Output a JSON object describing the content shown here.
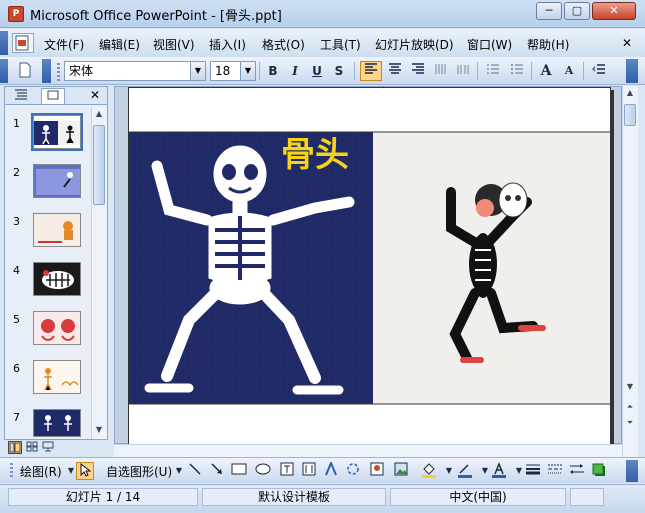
{
  "window": {
    "app_icon": "P",
    "title": "Microsoft Office PowerPoint - [骨头.ppt]",
    "minimize": "─",
    "restore": "▢",
    "close": "✕"
  },
  "menu": {
    "items": [
      "文件(F)",
      "编辑(E)",
      "视图(V)",
      "插入(I)",
      "格式(O)",
      "工具(T)",
      "幻灯片放映(D)",
      "窗口(W)",
      "帮助(H)"
    ],
    "close_doc": "✕"
  },
  "toolbar": {
    "font_name": "宋体",
    "font_size": "18",
    "bold": "B",
    "italic": "I",
    "underline": "U",
    "shadow": "S",
    "increase_font": "A",
    "decrease_font": "A"
  },
  "slides_pane": {
    "tab_close": "✕",
    "slide_numbers": [
      "1",
      "2",
      "3",
      "4",
      "5",
      "6",
      "7"
    ]
  },
  "slide": {
    "title_text": "骨头"
  },
  "drawbar": {
    "draw_label": "绘图(R)",
    "autoshapes_label": "自选图形(U)"
  },
  "status": {
    "slide_indicator": "幻灯片 1 / 14",
    "design_template": "默认设计模板",
    "language": "中文(中国)"
  },
  "colors": {
    "slide_left_bg": "#1f2a66",
    "title_yellow": "#f6d31a",
    "accent_blue": "#3a6fc2"
  }
}
